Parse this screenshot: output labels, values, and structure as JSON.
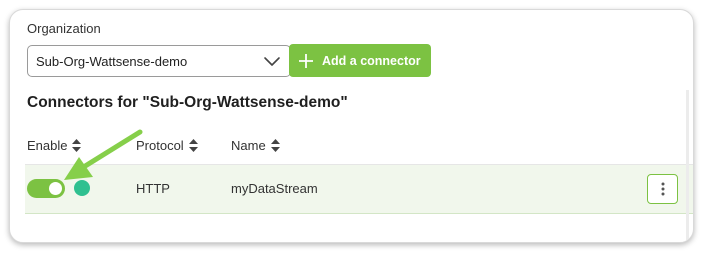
{
  "organization": {
    "label": "Organization",
    "selected": "Sub-Org-Wattsense-demo"
  },
  "add_button": {
    "label": "Add a connector"
  },
  "section": {
    "title": "Connectors for \"Sub-Org-Wattsense-demo\""
  },
  "table": {
    "headers": [
      {
        "label": "Enable"
      },
      {
        "label": "Protocol"
      },
      {
        "label": "Name"
      }
    ],
    "rows": [
      {
        "enabled": true,
        "status": "active",
        "protocol": "HTTP",
        "name": "myDataStream"
      }
    ]
  },
  "colors": {
    "accent": "#7cc242",
    "status": "#2fc090",
    "row_highlight": "#f1f7ec",
    "arrow": "#86cf4a"
  },
  "icons": {
    "dropdown": "chevron-down-icon",
    "add": "plus-icon",
    "sort": "sort-icon",
    "more": "more-vertical-icon",
    "annotation": "arrow-annotation-icon"
  }
}
